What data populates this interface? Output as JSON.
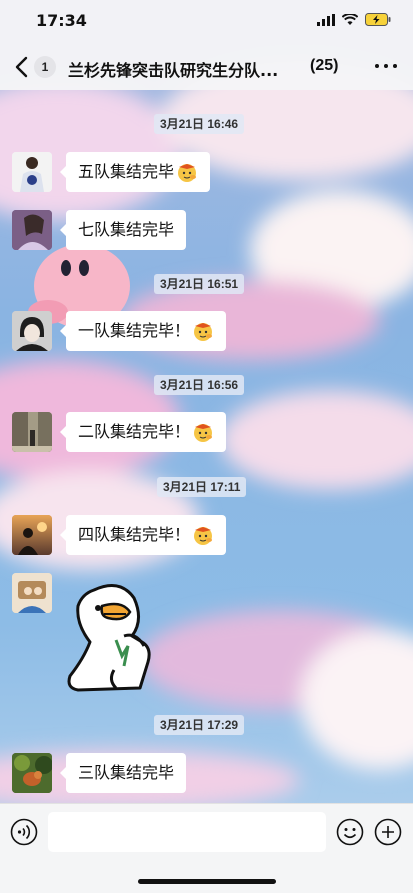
{
  "status_bar": {
    "time": "17:34"
  },
  "header": {
    "unread_count": "1",
    "title": "兰杉先锋突击队研究生分队...",
    "member_count": "(25)"
  },
  "messages": [
    {
      "timestamp": "3月21日 16:46",
      "text": "五队集结完毕",
      "emoji": "salute-emoji"
    },
    {
      "timestamp": "",
      "text": "七队集结完毕",
      "emoji": ""
    },
    {
      "timestamp": "3月21日 16:51",
      "text": "一队集结完毕！",
      "emoji": "salute-emoji"
    },
    {
      "timestamp": "3月21日 16:56",
      "text": "二队集结完毕！",
      "emoji": "salute-emoji"
    },
    {
      "timestamp": "3月21日 17:11",
      "text": "四队集结完毕！",
      "emoji": "salute-emoji"
    },
    {
      "timestamp": "",
      "text": "",
      "sticker": "duck-sticker"
    },
    {
      "timestamp": "3月21日 17:29",
      "text": "三队集结完毕",
      "emoji": ""
    }
  ],
  "input": {
    "placeholder": "",
    "value": ""
  },
  "colors": {
    "bubble": "#ffffff",
    "timestamp_bg": "#e1e8f5",
    "nav_bg": "#f5f5f7"
  }
}
